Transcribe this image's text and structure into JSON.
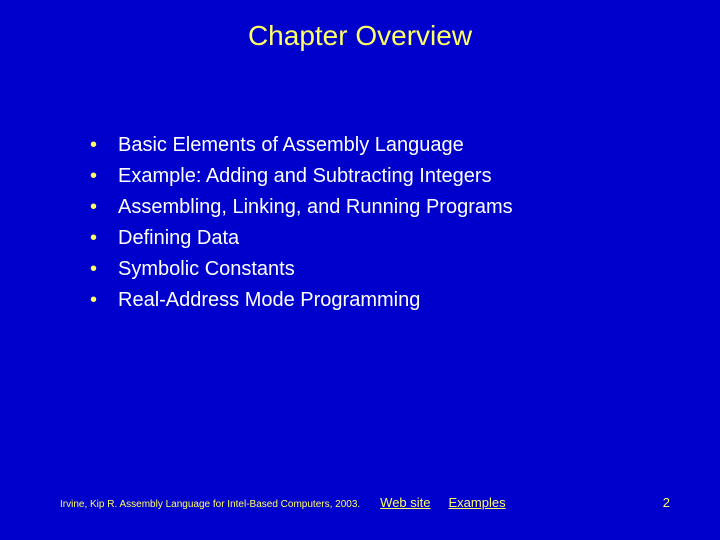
{
  "title": "Chapter Overview",
  "bullets": {
    "b0": "Basic Elements of Assembly Language",
    "b1": "Example: Adding and Subtracting Integers",
    "b2": "Assembling, Linking, and Running Programs",
    "b3": "Defining Data",
    "b4": "Symbolic Constants",
    "b5": "Real-Address Mode Programming"
  },
  "footer": {
    "attribution": "Irvine, Kip R. Assembly Language for Intel-Based Computers, 2003.",
    "link1": "Web site",
    "link2": "Examples",
    "page": "2"
  }
}
